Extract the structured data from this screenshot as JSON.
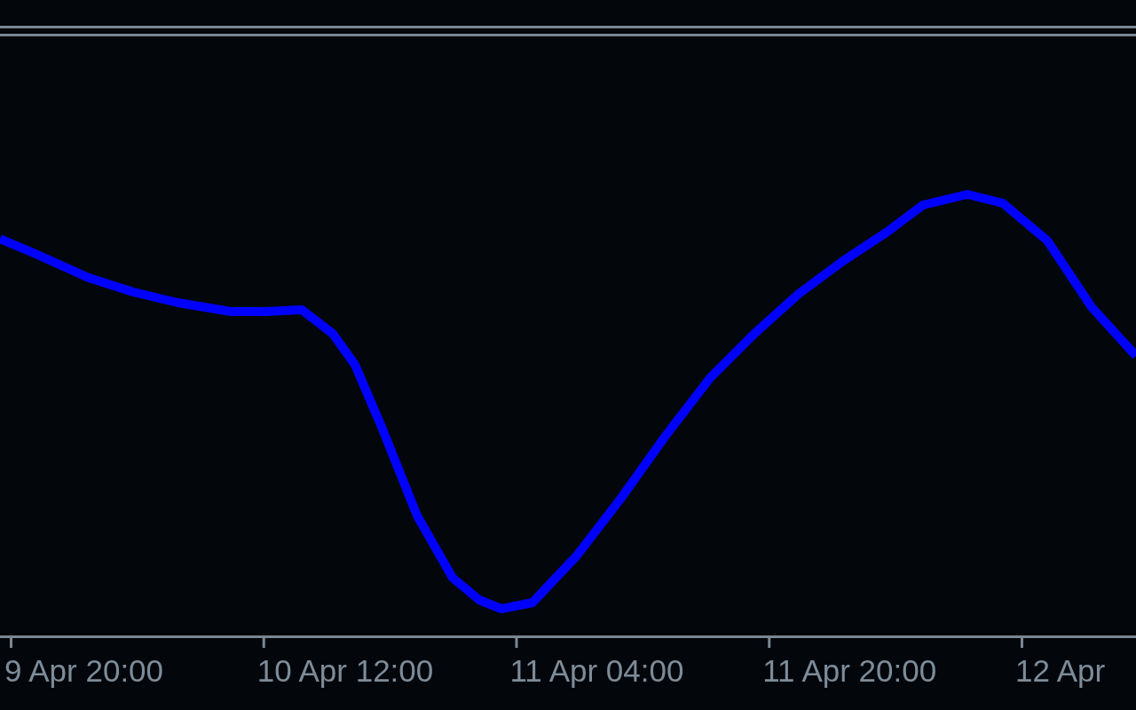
{
  "chart": {
    "x_axis_labels": [
      "9 Apr 20:00",
      "10 Apr 12:00",
      "11 Apr 04:00",
      "11 Apr 20:00",
      "12 Apr"
    ]
  }
}
